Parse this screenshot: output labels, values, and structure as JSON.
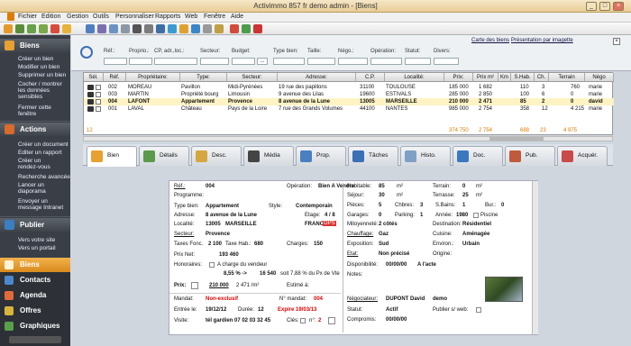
{
  "window": {
    "title": "Activimmo 857 fr demo admin  - [Biens]",
    "minimize": "_",
    "maximize": "□",
    "close": "×"
  },
  "menu": [
    "Fichier",
    "Edition",
    "Gestion",
    "Outils",
    "Personnaliser",
    "Rapports",
    "Web",
    "Fenêtre",
    "Aide"
  ],
  "sidebar": {
    "sections": [
      {
        "title": "Biens",
        "items": [
          "Créer un bien",
          "Modifier un bien",
          "Supprimer un bien",
          "Cocher / montrer les données sensibles",
          "Fermer cette fenêtre"
        ]
      },
      {
        "title": "Actions",
        "items": [
          "Créer un document",
          "Editer un rapport",
          "Créer un rendez-vous",
          "Recherche avancée",
          "Lancer un diaporama",
          "Envoyer un message Intranet"
        ]
      },
      {
        "title": "Publier",
        "items": [
          "Vers votre site",
          "Vers un portail"
        ]
      }
    ],
    "bottom": [
      "Biens",
      "Contacts",
      "Agenda",
      "Offres",
      "Graphiques"
    ]
  },
  "search": {
    "links": [
      "Carte des biens",
      "Présentation par imagette"
    ],
    "labels": [
      "Réf.:",
      "Proprio.:",
      "CP, adr.,loc.:",
      "Secteur:",
      "Budget:",
      "Type bien:",
      "Taille:",
      "Négo.:",
      "Opération:",
      "Statut:",
      "Divers:"
    ],
    "budget_btn": "..."
  },
  "grid": {
    "columns": [
      "Sél.",
      "Réf.",
      "Propriétaire:",
      "Type:",
      "Secteur:",
      "Adresse:",
      "C.P.",
      "Localité:",
      "Prix:",
      "Prix m²",
      "Km",
      "S.Hab.",
      "Ch.",
      "Terrain",
      "Négo"
    ],
    "rows": [
      {
        "ref": "002",
        "owner": "MOREAU",
        "type": "Pavillon",
        "sector": "Midi-Pyrénées",
        "address": "19 rue des papillons",
        "cp": "31100",
        "city": "TOULOUSE",
        "price": "185 000",
        "pm2": "1 682",
        "km": "",
        "shab": "110",
        "ch": "3",
        "terrain": "760",
        "nego": "marie"
      },
      {
        "ref": "003",
        "owner": "MARTIN",
        "type": "Propriété bourg",
        "sector": "Limousin",
        "address": "9 avenue des Lilas",
        "cp": "19600",
        "city": "ESTIVALS",
        "price": "285 000",
        "pm2": "2 850",
        "km": "",
        "shab": "100",
        "ch": "6",
        "terrain": "0",
        "nego": "marie"
      },
      {
        "ref": "004",
        "owner": "LAFONT",
        "type": "Appartement",
        "sector": "Provence",
        "address": "8 avenue de la Lune",
        "cp": "13005",
        "city": "MARSEILLE",
        "price": "210 000",
        "pm2": "2 471",
        "km": "",
        "shab": "85",
        "ch": "2",
        "terrain": "0",
        "nego": "david"
      },
      {
        "ref": "001",
        "owner": "LAVAL",
        "type": "Château",
        "sector": "Pays de la Loire",
        "address": "7 rue des Grands Volumes",
        "cp": "44100",
        "city": "NANTES",
        "price": "985 000",
        "pm2": "2 754",
        "km": "",
        "shab": "358",
        "ch": "12",
        "terrain": "4 215",
        "nego": "marie"
      }
    ],
    "footer": {
      "count": "12",
      "price_avg": "374 750",
      "pm2_avg": "2 754",
      "shab_sum": "688",
      "ch_sum": "23",
      "terrain_sum": "4 975"
    }
  },
  "tabs": [
    "Bien",
    "Détails",
    "Desc.",
    "Média",
    "Prop.",
    "Tâches",
    "Histo.",
    "Doc.",
    "Pub.",
    "Acquér."
  ],
  "detail": {
    "ref_l": "Réf.:",
    "ref": "004",
    "operation_l": "Opération:",
    "operation": "Bien A Vendre",
    "programme_l": "Programme:",
    "type_l": "Type bien:",
    "type": "Appartement",
    "style_l": "Style:",
    "style": "Contemporain",
    "adresse_l": "Adresse:",
    "adresse": "8 avenue de la Lune",
    "etage_l": "Etage:",
    "etage": "4 / 8",
    "localite_l": "Localité:",
    "cp": "13005",
    "ville": "MARSEILLE",
    "pays": "FRANCE",
    "gps": "GPS",
    "secteur_l": "Secteur:",
    "secteur": "Provence",
    "taxes_l": "Taxes Fonc.",
    "taxes": "2 100",
    "taxehab_l": "Taxe Hab.:",
    "taxehab": "680",
    "charges_l": "Charges:",
    "charges": "150",
    "prixnet_l": "Prix Net:",
    "prixnet": "193 460",
    "honoraires_l": "Honoraires:",
    "honoraires": "A charge du vendeur",
    "pct": "8,55 % ->",
    "honor_val": "16 540",
    "honor_txt": "soit 7,88 % du Px de Vte",
    "prix_l": "Prix:",
    "prix": "210 000",
    "prixm2": "2 471 /m²",
    "estime_l": "Estimé à:",
    "mandat_l": "Mandat:",
    "mandat": "Non-exclusif",
    "nmandat_l": "N° mandat:",
    "nmandat": "004",
    "entree_l": "Entrée le:",
    "entree": "19/12/12",
    "duree_l": "Durée:",
    "duree": "12",
    "expire": "Expire 19/03/13",
    "visite_l": "Visite:",
    "visite": "tél gardien 07 02 03 32 45",
    "cles_l": "Clés:",
    "nkey_l": "n°:",
    "nkey": "2",
    "hab_l": "Habitable:",
    "hab": "85",
    "terrain_l": "Terrain:",
    "terrain": "0",
    "m2": "m²",
    "sejour_l": "Séjour:",
    "sejour": "30",
    "terrasse_l": "Terrasse:",
    "terrasse": "25",
    "pieces_l": "Pièces:",
    "pieces": "5",
    "chbres_l": "Chbres:",
    "chbres": "3",
    "sbains_l": "S.Bains:",
    "sbains": "1",
    "bur_l": "Bur.:",
    "bur": "0",
    "garages_l": "Garages:",
    "garages": "0",
    "parking_l": "Parking:",
    "parking": "1",
    "annee_l": "Année:",
    "annee": "1980",
    "piscine_l": "Piscine",
    "mitoy_l": "Mitoyenneté:",
    "mitoy": "2 côtés",
    "dest_l": "Destination:",
    "dest": "Résidentiel",
    "chauff_l": "Chauffage:",
    "chauff": "Gaz",
    "cuisine_l": "Cuisine:",
    "cuisine": "Aménagée",
    "expo_l": "Exposition:",
    "expo": "Sud",
    "environ_l": "Environ.:",
    "environ": "Urbain",
    "etat_l": "Etat:",
    "etat": "Non précisé",
    "origine_l": "Origine:",
    "dispo_l": "Disponibilité:",
    "dispo": "00/00/00",
    "dispo_txt": "A l'acte",
    "notes_l": "Notes:",
    "nego_l": "Négociateur:",
    "nego": "DUPONT David",
    "nego_s": "demo",
    "statut_l": "Statut:",
    "statut": "Actif",
    "publier_l": "Publier s/ web:",
    "compromis_l": "Compromis:",
    "compromis": "00/00/00"
  },
  "colors": {
    "accent": "#e07a00",
    "selected_row": "#fff3c4",
    "red": "#d00000"
  }
}
